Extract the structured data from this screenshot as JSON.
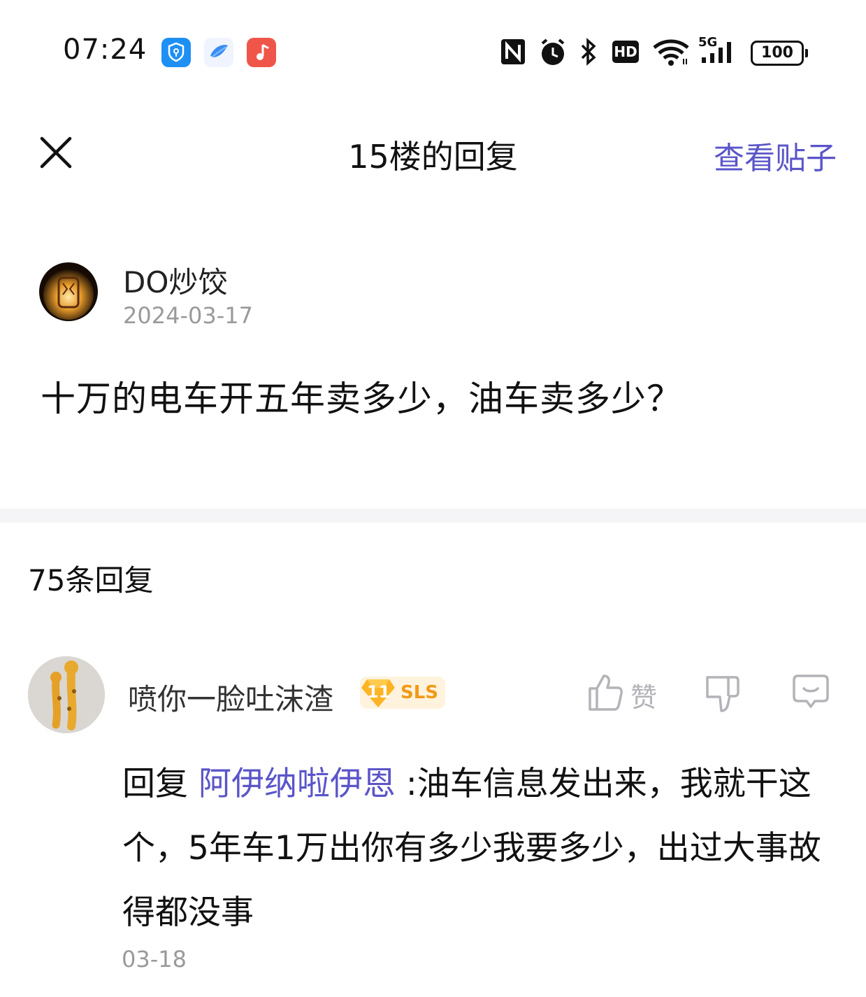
{
  "status_bar": {
    "time": "07:24",
    "battery": "100",
    "network": "5G",
    "hd": "HD",
    "icons": [
      "shield-app-icon",
      "bird-app-icon",
      "music-app-icon",
      "nfc-icon",
      "alarm-icon",
      "bluetooth-icon",
      "hd-icon",
      "wifi-icon",
      "signal-icon",
      "battery-icon"
    ]
  },
  "header": {
    "title": "15楼的回复",
    "view_post": "查看贴子",
    "accent_color": "#5b55c9"
  },
  "post": {
    "author": "DO炒饺",
    "date": "2024-03-17",
    "text": "十万的电车开五年卖多少，油车卖多少？"
  },
  "replies_section": {
    "count_label": "75条回复"
  },
  "reply": {
    "user": "喷你一脸吐沫渣",
    "level": "11",
    "level_tag": "SLS",
    "like_label": "赞",
    "prefix": "回复",
    "mention": "阿伊纳啦伊恩",
    "text": ":油车信息发出来，我就干这个，5年车1万出你有多少我要多少，出过大事故得都没事",
    "date": "03-18"
  }
}
